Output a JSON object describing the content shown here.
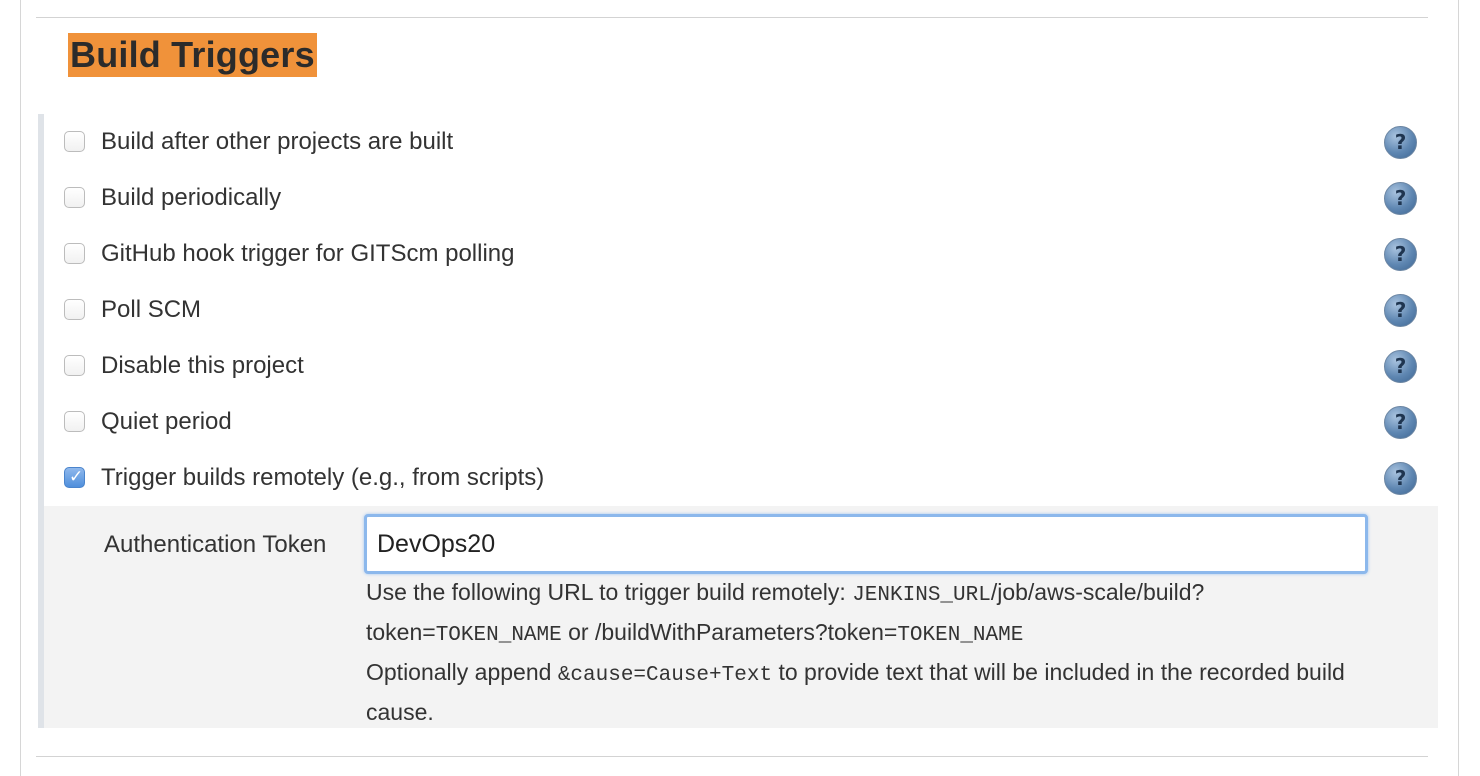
{
  "section": {
    "title": "Build Triggers",
    "highlight_color": "#f0923a"
  },
  "triggers": [
    {
      "label": "Build after other projects are built",
      "checked": false,
      "help_icon": "question-circle-icon"
    },
    {
      "label": "Build periodically",
      "checked": false,
      "help_icon": "question-circle-icon"
    },
    {
      "label": "GitHub hook trigger for GITScm polling",
      "checked": false,
      "help_icon": "question-circle-icon"
    },
    {
      "label": "Poll SCM",
      "checked": false,
      "help_icon": "question-circle-icon"
    },
    {
      "label": "Disable this project",
      "checked": false,
      "help_icon": "question-circle-icon"
    },
    {
      "label": "Quiet period",
      "checked": false,
      "help_icon": "question-circle-icon"
    },
    {
      "label": "Trigger builds remotely (e.g., from scripts)",
      "checked": true,
      "help_icon": "question-circle-icon"
    }
  ],
  "remote_trigger": {
    "token_label": "Authentication Token",
    "token_value": "DevOps20",
    "help": {
      "line1_prefix": "Use the following URL to trigger build remotely: ",
      "jenkins_url": "JENKINS_URL",
      "line1_path": "/job/aws-scale/build?",
      "line2_prefix": "token=",
      "token_name_1": "TOKEN_NAME",
      "line2_middle": " or /buildWithParameters?token=",
      "token_name_2": "TOKEN_NAME",
      "line3_prefix": "Optionally append ",
      "cause_param": "&cause=Cause+Text",
      "line3_suffix": " to provide text that will be included in the recorded build cause."
    }
  }
}
